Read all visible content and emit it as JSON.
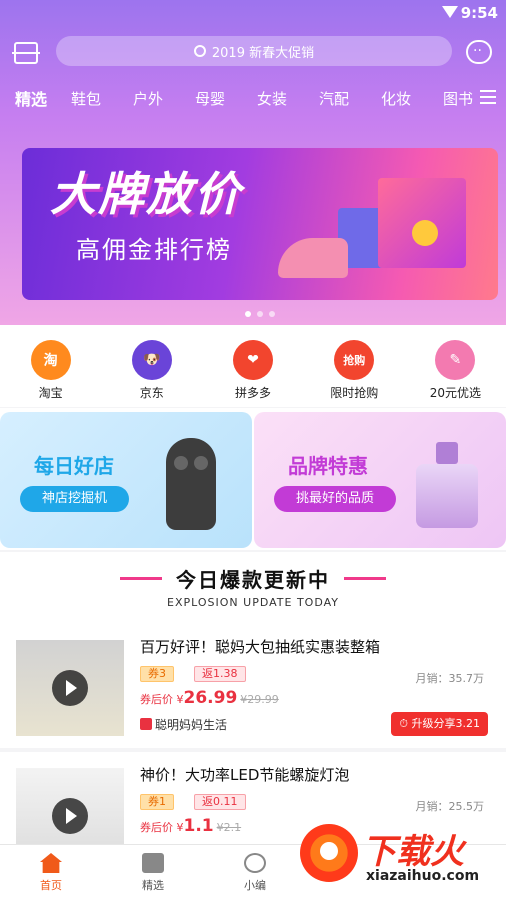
{
  "status": {
    "time": "9:54"
  },
  "header": {
    "search_placeholder": "2019 新春大促销"
  },
  "categories": [
    "精选",
    "鞋包",
    "户外",
    "母婴",
    "女装",
    "汽配",
    "化妆",
    "图书"
  ],
  "banner": {
    "title": "大牌放价",
    "subtitle": "高佣金排行榜"
  },
  "quick_links": [
    {
      "label": "淘宝",
      "glyph": "淘",
      "color": "#ff8a1e"
    },
    {
      "label": "京东",
      "glyph": "狗",
      "color": "#6a44d8"
    },
    {
      "label": "拼多多",
      "glyph": "拼",
      "color": "#f2452e"
    },
    {
      "label": "限时抢购",
      "glyph": "抢购",
      "color": "#f2452e"
    },
    {
      "label": "20元优选",
      "glyph": "券",
      "color": "#f37ab0"
    }
  ],
  "promos": {
    "left": {
      "title": "每日好店",
      "button": "神店挖掘机",
      "color": "#1fa7e8"
    },
    "right": {
      "title": "品牌特惠",
      "button": "挑最好的品质",
      "color": "#c23bd6"
    }
  },
  "section": {
    "title": "今日爆款更新中",
    "subtitle": "EXPLOSION UPDATE TODAY"
  },
  "products": [
    {
      "title": "百万好评！聪妈大包抽纸实惠装整箱",
      "coupon": "券3",
      "rebate": "返1.38",
      "sales": "月销：35.7万",
      "price_label": "券后价 ¥",
      "price": "26.99",
      "orig_price": "¥29.99",
      "shop": "聪明妈妈生活",
      "share": "升级分享3.21"
    },
    {
      "title": "神价！大功率LED节能螺旋灯泡",
      "coupon": "券1",
      "rebate": "返0.11",
      "sales": "月销：25.5万",
      "price_label": "券后价 ¥",
      "price": "1.1",
      "orig_price": "¥2.1"
    }
  ],
  "tabs": [
    {
      "label": "首页",
      "active": true
    },
    {
      "label": "精选",
      "active": false
    },
    {
      "label": "小编",
      "active": false
    }
  ],
  "watermark": {
    "text": "下载火",
    "url": "xiazaihuo.com"
  }
}
